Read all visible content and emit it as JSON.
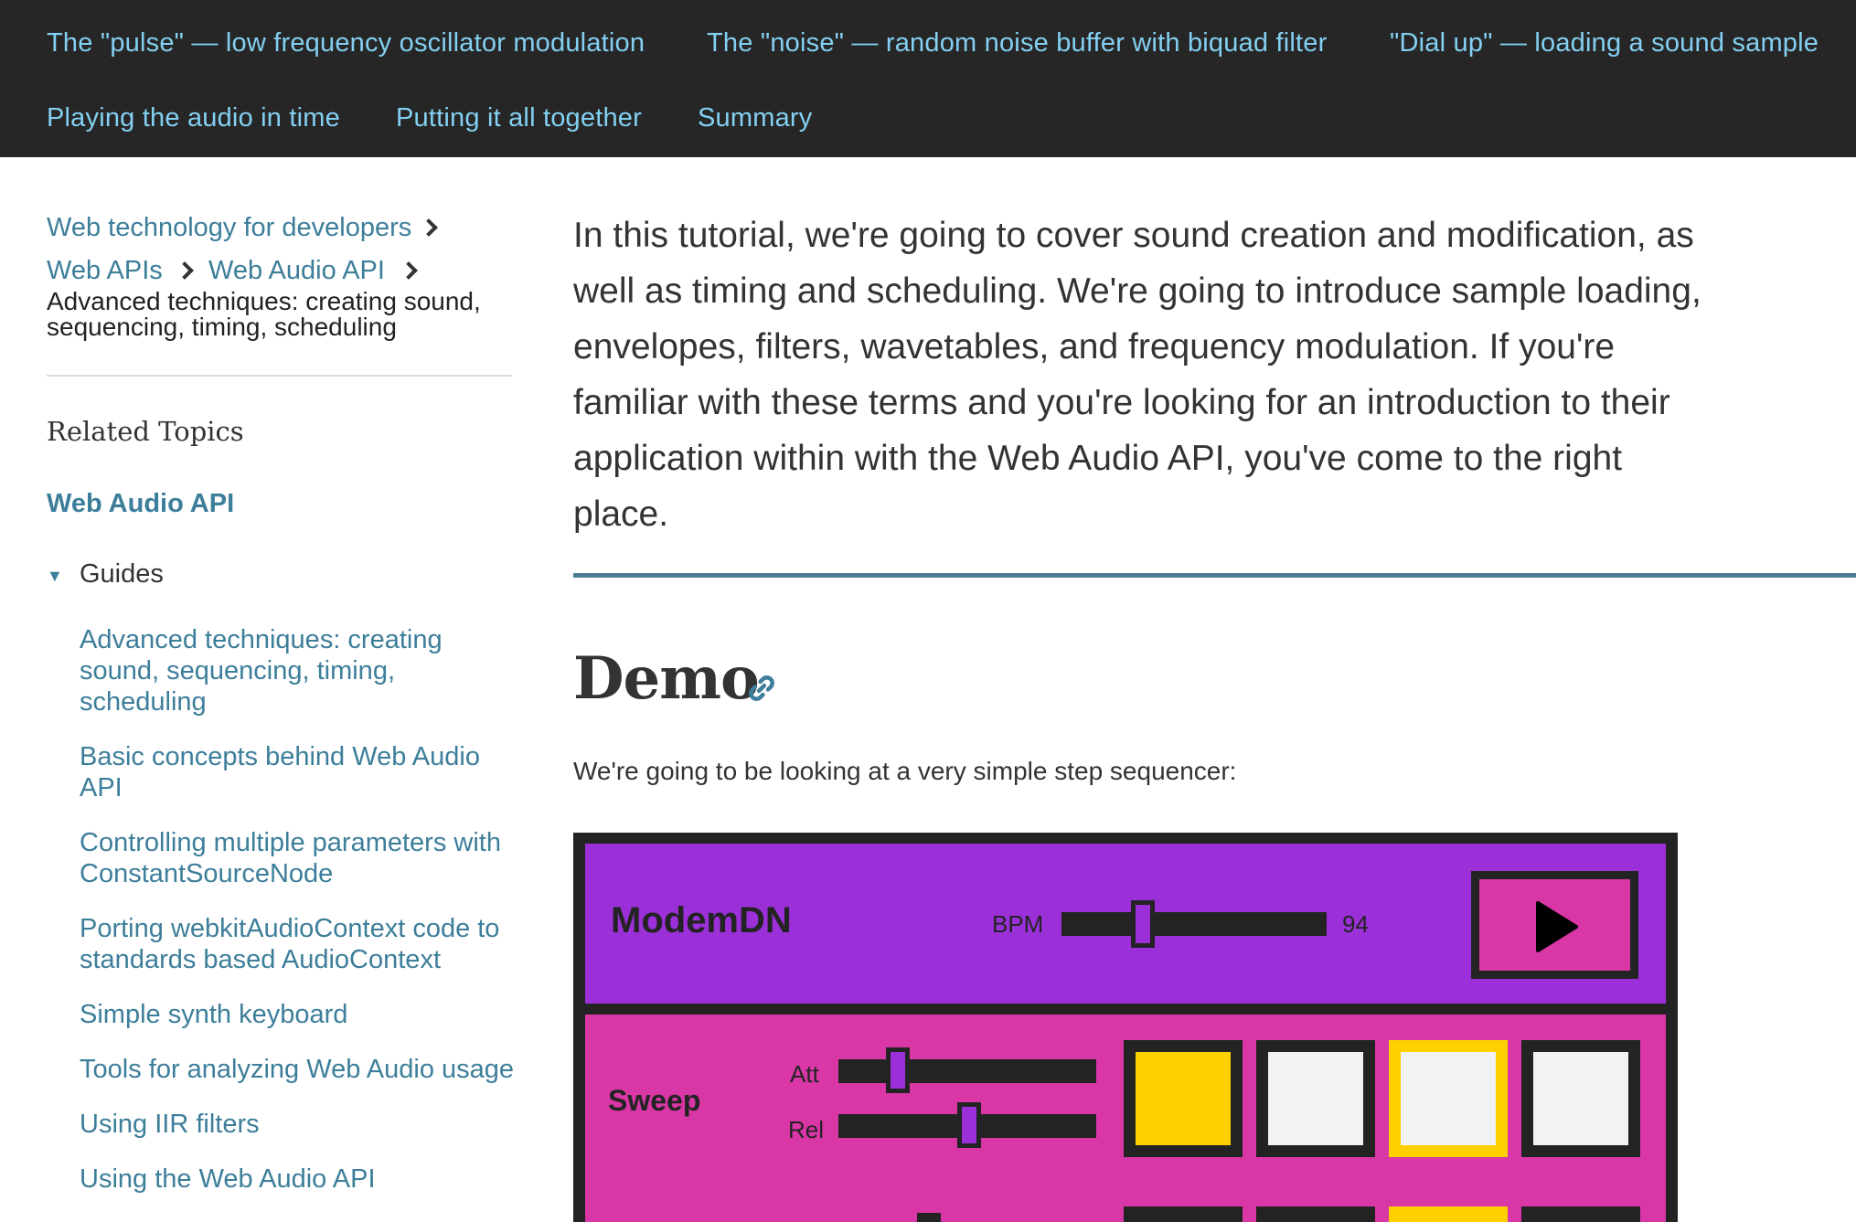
{
  "toc": {
    "items": [
      "The \"pulse\" — low frequency oscillator modulation",
      "The \"noise\" — random noise buffer with biquad filter",
      "\"Dial up\" — loading a sound sample",
      "Playing the audio in time",
      "Putting it all together",
      "Summary"
    ]
  },
  "breadcrumbs": {
    "items": [
      "Web technology for developers",
      "Web APIs",
      "Web Audio API"
    ],
    "current": "Advanced techniques: creating sound, sequencing, timing, scheduling"
  },
  "sidebar": {
    "related_title": "Related Topics",
    "api_link": "Web Audio API",
    "guides_label": "Guides",
    "guides_toggle": "▼",
    "guides": [
      "Advanced techniques: creating sound, sequencing, timing, scheduling",
      "Basic concepts behind Web Audio API",
      "Controlling multiple parameters with ConstantSourceNode",
      "Porting webkitAudioContext code to standards based AudioContext",
      "Simple synth keyboard",
      "Tools for analyzing Web Audio usage",
      "Using IIR filters",
      "Using the Web Audio API"
    ]
  },
  "main": {
    "intro": "In this tutorial, we're going to cover sound creation and modification, as well as timing and scheduling. We're going to introduce sample loading, envelopes, filters, wavetables, and frequency modulation. If you're familiar with these terms and you're looking for an introduction to their application within with the Web Audio API, you've come to the right place.",
    "demo_heading": "Demo",
    "demo_description": "We're going to be looking at a very simple step sequencer:"
  },
  "sequencer": {
    "title": "ModemDN",
    "bpm_label": "BPM",
    "bpm_value": "94",
    "bpm_level": 0.24,
    "row_label": "Sweep",
    "att_label": "Att",
    "rel_label": "Rel",
    "att_level": 0.18,
    "rel_level": 0.47,
    "pads": [
      "on",
      "off",
      "highlighted",
      "off"
    ],
    "colors": {
      "frame": "#232323",
      "header": "#9b30d9",
      "row": "#d936a6",
      "pad_on": "#ffd000",
      "pad_off": "#f2f2f2"
    }
  },
  "colors": {
    "topbar_bg": "#262626",
    "topbar_link": "#83d0f2",
    "link": "#3d7e9a",
    "rule": "#4d7e98"
  }
}
